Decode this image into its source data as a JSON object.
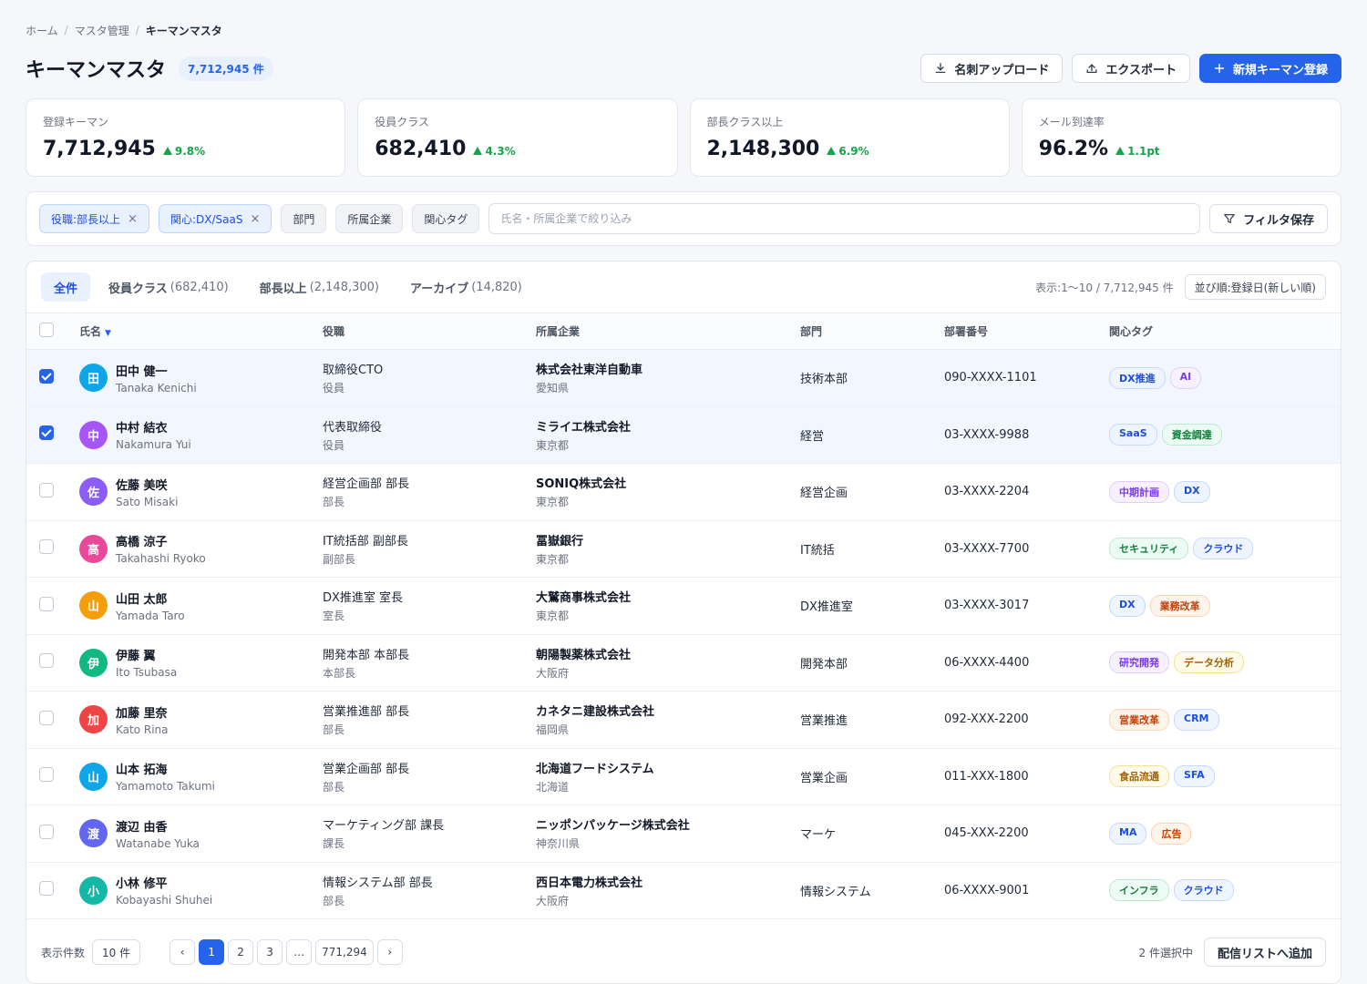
{
  "breadcrumb": {
    "home": "ホーム",
    "master": "マスタ管理",
    "current": "キーマンマスタ"
  },
  "header": {
    "title": "キーマンマスタ",
    "count": "7,712,945 件",
    "upload_label": "名刺アップロード",
    "export_label": "エクスポート",
    "new_label": "新規キーマン登録"
  },
  "kpis": [
    {
      "label": "登録キーマン",
      "value": "7,712,945",
      "delta": "9.8%"
    },
    {
      "label": "役員クラス",
      "value": "682,410",
      "delta": "4.3%"
    },
    {
      "label": "部長クラス以上",
      "value": "2,148,300",
      "delta": "6.9%"
    },
    {
      "label": "メール到達率",
      "value": "96.2%",
      "delta": "1.1pt"
    }
  ],
  "filters": {
    "active": [
      "役職:部長以上",
      "関心:DX/SaaS"
    ],
    "plain": [
      "部門",
      "所属企業",
      "関心タグ"
    ],
    "search_placeholder": "氏名・所属企業で絞り込み",
    "save_label": "フィルタ保存"
  },
  "tabs": [
    {
      "label": "全件",
      "count": ""
    },
    {
      "label": "役員クラス",
      "count": "(682,410)"
    },
    {
      "label": "部長以上",
      "count": "(2,148,300)"
    },
    {
      "label": "アーカイブ",
      "count": "(14,820)"
    }
  ],
  "range": "表示:1〜10 / 7,712,945 件",
  "sort": "並び順:登録日(新しい順)",
  "columns": {
    "name": "氏名",
    "title": "役職",
    "company": "所属企業",
    "dept": "部門",
    "phone": "部署番号",
    "tags": "関心タグ"
  },
  "rows": [
    {
      "initial": "田",
      "color": "#0ea5e9",
      "name": "田中 健一",
      "romaji": "Tanaka Kenichi",
      "title": "取締役CTO",
      "rank": "役員",
      "company": "株式会社東洋自動車",
      "pref": "愛知県",
      "dept": "技術本部",
      "phone": "090-XXXX-1101",
      "tags": [
        "DX推進",
        "AI"
      ],
      "checked": true
    },
    {
      "initial": "中",
      "color": "#a855f7",
      "name": "中村 結衣",
      "romaji": "Nakamura Yui",
      "title": "代表取締役",
      "rank": "役員",
      "company": "ミライエ株式会社",
      "pref": "東京都",
      "dept": "経営",
      "phone": "03-XXXX-9988",
      "tags": [
        "SaaS",
        "資金調達"
      ],
      "checked": true
    },
    {
      "initial": "佐",
      "color": "#8b5cf6",
      "name": "佐藤 美咲",
      "romaji": "Sato Misaki",
      "title": "経営企画部 部長",
      "rank": "部長",
      "company": "SONIQ株式会社",
      "pref": "東京都",
      "dept": "経営企画",
      "phone": "03-XXXX-2204",
      "tags": [
        "中期計画",
        "DX"
      ],
      "checked": false
    },
    {
      "initial": "高",
      "color": "#ec4899",
      "name": "高橋 涼子",
      "romaji": "Takahashi Ryoko",
      "title": "IT統括部 副部長",
      "rank": "副部長",
      "company": "冨嶽銀行",
      "pref": "東京都",
      "dept": "IT統括",
      "phone": "03-XXXX-7700",
      "tags": [
        "セキュリティ",
        "クラウド"
      ],
      "checked": false
    },
    {
      "initial": "山",
      "color": "#f59e0b",
      "name": "山田 太郎",
      "romaji": "Yamada Taro",
      "title": "DX推進室 室長",
      "rank": "室長",
      "company": "大鷲商事株式会社",
      "pref": "東京都",
      "dept": "DX推進室",
      "phone": "03-XXXX-3017",
      "tags": [
        "DX",
        "業務改革"
      ],
      "checked": false
    },
    {
      "initial": "伊",
      "color": "#10b981",
      "name": "伊藤 翼",
      "romaji": "Ito Tsubasa",
      "title": "開発本部 本部長",
      "rank": "本部長",
      "company": "朝陽製薬株式会社",
      "pref": "大阪府",
      "dept": "開発本部",
      "phone": "06-XXXX-4400",
      "tags": [
        "研究開発",
        "データ分析"
      ],
      "checked": false
    },
    {
      "initial": "加",
      "color": "#ef4444",
      "name": "加藤 里奈",
      "romaji": "Kato Rina",
      "title": "営業推進部 部長",
      "rank": "部長",
      "company": "カネタニ建設株式会社",
      "pref": "福岡県",
      "dept": "営業推進",
      "phone": "092-XXX-2200",
      "tags": [
        "営業改革",
        "CRM"
      ],
      "checked": false
    },
    {
      "initial": "山",
      "color": "#0ea5e9",
      "name": "山本 拓海",
      "romaji": "Yamamoto Takumi",
      "title": "営業企画部 部長",
      "rank": "部長",
      "company": "北海道フードシステム",
      "pref": "北海道",
      "dept": "営業企画",
      "phone": "011-XXX-1800",
      "tags": [
        "食品流通",
        "SFA"
      ],
      "checked": false
    },
    {
      "initial": "渡",
      "color": "#6366f1",
      "name": "渡辺 由香",
      "romaji": "Watanabe Yuka",
      "title": "マーケティング部 課長",
      "rank": "課長",
      "company": "ニッポンパッケージ株式会社",
      "pref": "神奈川県",
      "dept": "マーケ",
      "phone": "045-XXX-2200",
      "tags": [
        "MA",
        "広告"
      ],
      "checked": false
    },
    {
      "initial": "小",
      "color": "#14b8a6",
      "name": "小林 修平",
      "romaji": "Kobayashi Shuhei",
      "title": "情報システム部 部長",
      "rank": "部長",
      "company": "西日本電力株式会社",
      "pref": "大阪府",
      "dept": "情報システム",
      "phone": "06-XXXX-9001",
      "tags": [
        "インフラ",
        "クラウド"
      ],
      "checked": false
    }
  ],
  "tag_colors": [
    "blue",
    "purple",
    "blue",
    "green",
    "purple",
    "blue",
    "green",
    "blue",
    "blue",
    "orange",
    "purple",
    "yellow",
    "orange",
    "blue",
    "yellow",
    "blue",
    "blue",
    "orange",
    "green",
    "blue"
  ],
  "footer": {
    "per_label": "表示件数",
    "per_value": "10 件",
    "pages": [
      "‹",
      "1",
      "2",
      "3",
      "…",
      "771,294",
      "›"
    ],
    "selected": "2 件選択中",
    "add_label": "配信リストへ追加"
  }
}
